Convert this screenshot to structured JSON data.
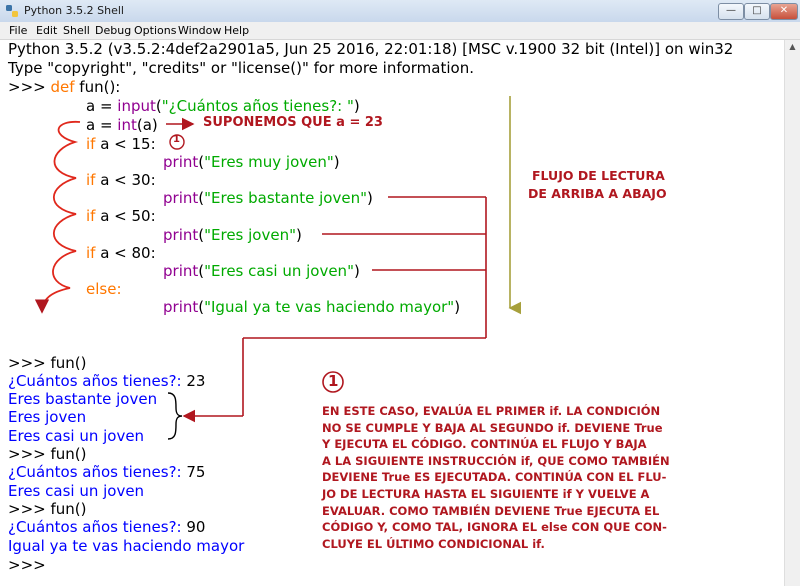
{
  "window": {
    "title": "Python 3.5.2 Shell",
    "minimize_label": "—",
    "maximize_label": "□",
    "close_label": "✕"
  },
  "menubar": [
    "File",
    "Edit",
    "Shell",
    "Debug",
    "Options",
    "Window",
    "Help"
  ],
  "shell": {
    "banner1": "Python 3.5.2 (v3.5.2:4def2a2901a5, Jun 25 2016, 22:01:18) [MSC v.1900 32 bit (Intel)] on win32",
    "banner2": "Type \"copyright\", \"credits\" or \"license()\" for more information.",
    "prompt": ">>> ",
    "def_kw": "def",
    "def_name": "fun():",
    "l2_a": "a = ",
    "l2_fn": "input",
    "l2_paren": "(",
    "l2_str": "\"¿Cuántos años tienes?: \"",
    "l2_close": ")",
    "l3_a": "a = ",
    "l3_fn": "int",
    "l3_rest": "(a)",
    "if_kw": "if",
    "cond1": " a < 15:",
    "cond2": " a < 30:",
    "cond3": " a < 50:",
    "cond4": " a < 80:",
    "else_kw": "else:",
    "print_fn": "print",
    "p1": "\"Eres muy joven\"",
    "p2": "\"Eres bastante joven\"",
    "p3": "\"Eres joven\"",
    "p4": "\"Eres casi un joven\"",
    "p5": "\"Igual ya te vas haciendo mayor\"",
    "open_paren": "(",
    "close_paren": ")",
    "call": "fun()",
    "ask": "¿Cuántos años tienes?: ",
    "in1": "23",
    "out1a": "Eres bastante joven",
    "out1b": "Eres joven",
    "out1c": "Eres casi un joven",
    "in2": "75",
    "out2a": "Eres casi un joven",
    "in3": "90",
    "out3a": "Igual ya te vas haciendo mayor",
    "final_prompt": ">>>"
  },
  "annotations": {
    "supposition": "SUPONEMOS QUE a = 23",
    "marker": "1",
    "flow_title_1": "FLUJO DE LECTURA",
    "flow_title_2": "DE ARRIBA A ABAJO",
    "note_lines": [
      "EN ESTE CASO, EVALÚA EL PRIMER if. LA CONDICIÓN",
      "NO SE CUMPLE Y BAJA AL SEGUNDO if. DEVIENE True",
      "Y EJECUTA EL CÓDIGO. CONTINÚA EL FLUJO Y BAJA",
      "A LA SIGUIENTE INSTRUCCIÓN if, QUE COMO TAMBIÉN",
      "DEVIENE True ES EJECUTADA. CONTINÚA CON EL FLU-",
      "JO DE LECTURA HASTA EL SIGUIENTE if Y VUELVE A",
      "EVALUAR. COMO TAMBIÉN DEVIENE True EJECUTA EL",
      "CÓDIGO Y, COMO TAL, IGNORA EL else CON QUE CON-",
      "CLUYE EL ÚLTIMO CONDICIONAL if."
    ]
  },
  "colors": {
    "keyword": "#ff7700",
    "builtin": "#900090",
    "string": "#00aa00",
    "output": "#0000ff",
    "annotation": "#b0171f",
    "flow_arrow": "#a7a03c"
  }
}
